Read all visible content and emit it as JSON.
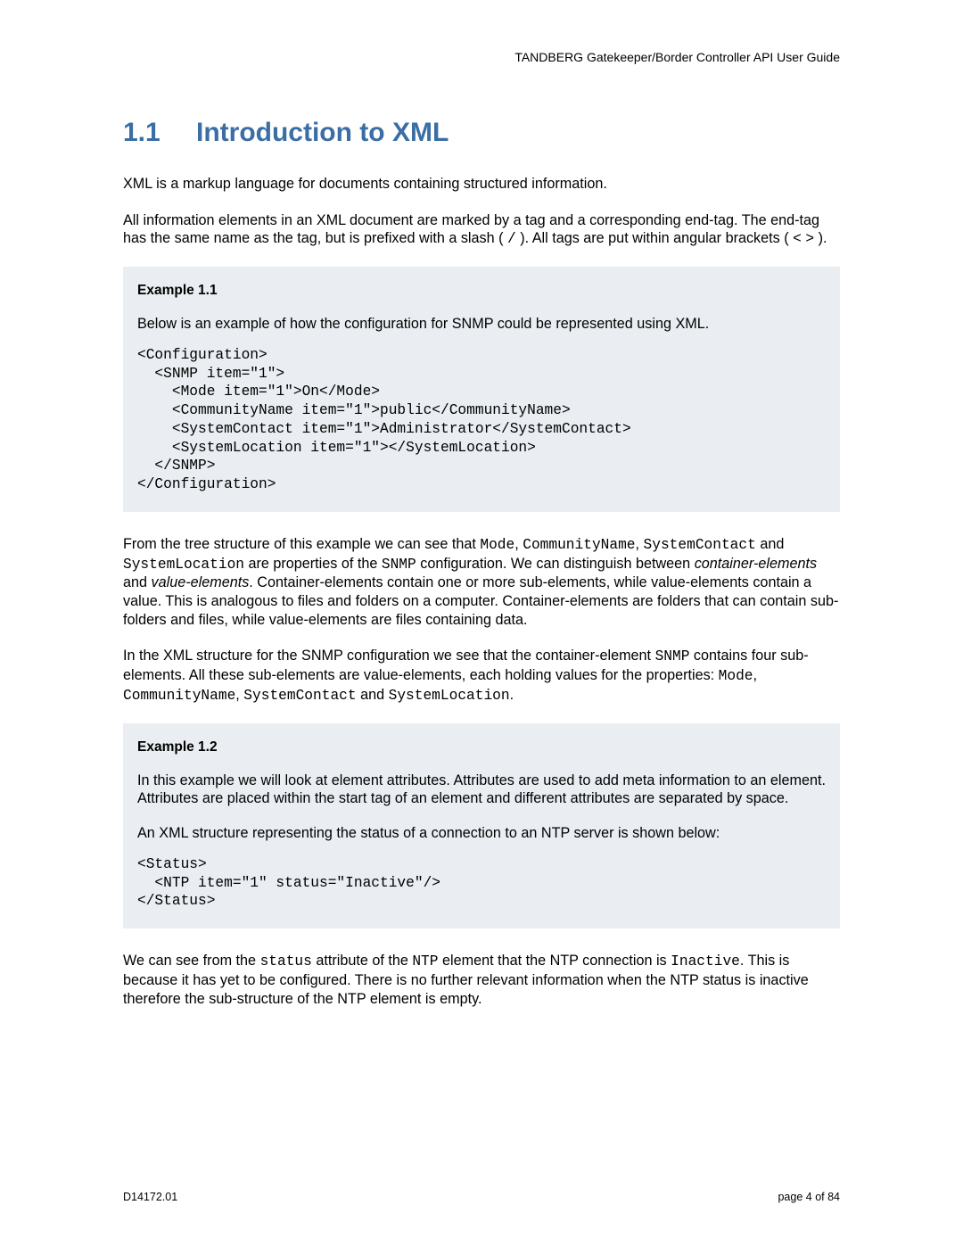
{
  "header": {
    "doc_title": "TANDBERG Gatekeeper/Border Controller API User Guide"
  },
  "section": {
    "number": "1.1",
    "title": "Introduction to XML"
  },
  "paragraphs": {
    "p1": "XML is a markup language for documents containing structured information.",
    "p2_a": "All information elements in an XML document are marked by a tag and a corresponding end-tag. The end-tag has the same name as the tag, but is prefixed with a slash ( ",
    "p2_slash": "/",
    "p2_b": " ). All tags are put within angular brackets ( ",
    "p2_lt": "<",
    "p2_sp": " ",
    "p2_gt": ">",
    "p2_c": " )."
  },
  "example1": {
    "title": "Example 1.1",
    "intro": "Below is an example of how the configuration for SNMP could be represented using XML.",
    "code": "<Configuration>\n  <SNMP item=\"1\">\n    <Mode item=\"1\">On</Mode>\n    <CommunityName item=\"1\">public</CommunityName>\n    <SystemContact item=\"1\">Administrator</SystemContact>\n    <SystemLocation item=\"1\"></SystemLocation>\n  </SNMP>\n</Configuration>"
  },
  "mid": {
    "p3_a": "From the tree structure of this example we can see that ",
    "p3_mode": "Mode",
    "p3_sep1": ", ",
    "p3_comm": "CommunityName",
    "p3_sep2": ", ",
    "p3_sysc": "SystemContact",
    "p3_and": " and ",
    "p3_sysl": "SystemLocation",
    "p3_b": " are properties of the ",
    "p3_snmp": "SNMP",
    "p3_c": " configuration. We can distinguish between ",
    "p3_ce": "container-elements",
    "p3_and2": " and ",
    "p3_ve": "value-elements",
    "p3_d": ". Container-elements contain one or more sub-elements, while value-elements contain a value. This is analogous to files and folders on a computer. Container-elements are folders that can contain sub-folders and files, while value-elements are files containing data.",
    "p4_a": "In the XML structure for the SNMP configuration we see that the container-element ",
    "p4_snmp": "SNMP",
    "p4_b": " contains four sub-elements. All these sub-elements are value-elements, each holding values for the properties: ",
    "p4_mode": "Mode",
    "p4_s1": ", ",
    "p4_comm": "CommunityName",
    "p4_s2": ", ",
    "p4_sysc": "SystemContact",
    "p4_and": " and ",
    "p4_sysl": "SystemLocation",
    "p4_c": "."
  },
  "example2": {
    "title": "Example 1.2",
    "p1": "In this example we will look at element attributes. Attributes are used to add meta information to an element. Attributes are placed within the start tag of an element and different attributes are separated by space.",
    "p2": "An XML structure representing the status of a connection to an NTP server is shown below:",
    "code": "<Status>\n  <NTP item=\"1\" status=\"Inactive\"/>\n</Status>"
  },
  "closing": {
    "a": "We can see from the ",
    "status": "status",
    "b": " attribute of the ",
    "ntp": "NTP",
    "c": " element that the NTP connection is ",
    "inactive": "Inactive",
    "d": ". This is because it has yet to be configured. There is no further relevant information when the NTP status is inactive therefore the sub-structure of the NTP element is empty."
  },
  "footer": {
    "doc_id": "D14172.01",
    "page": "page 4 of 84"
  }
}
